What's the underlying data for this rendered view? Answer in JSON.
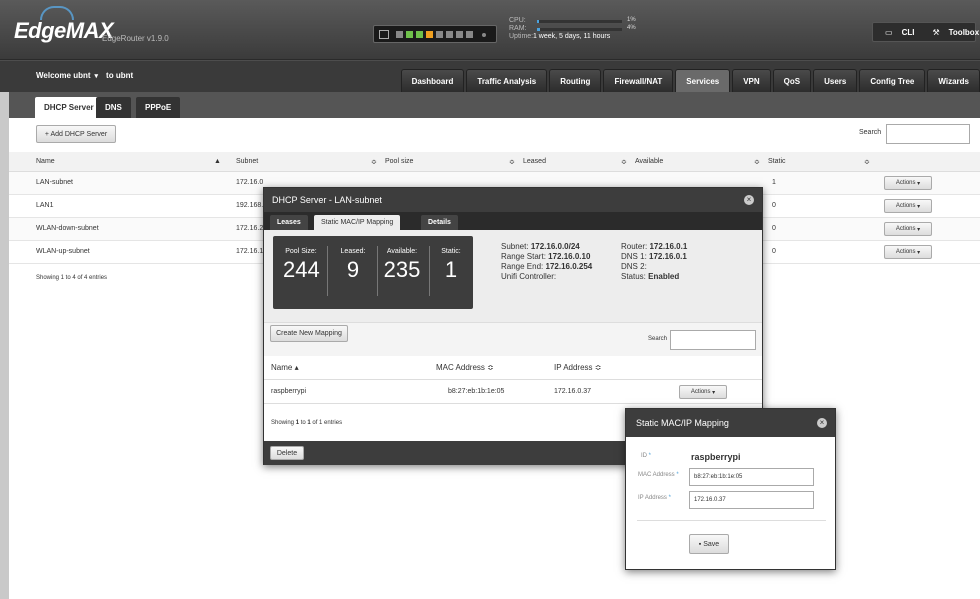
{
  "header": {
    "logo": "EdgeMAX",
    "router_name": "EdgeRouter v1.9.0",
    "cpu_label": "CPU:",
    "cpu_pct": "1%",
    "cpu_value": 1,
    "ram_label": "RAM:",
    "ram_pct": "4%",
    "ram_value": 4,
    "uptime_label": "Uptime:",
    "uptime_value": "1 week, 5 days, 11 hours",
    "cli_label": "CLI",
    "toolbox_label": "Toolbox"
  },
  "nav": {
    "welcome": "Welcome ubnt",
    "to": "to ubnt",
    "tabs": [
      "Dashboard",
      "Traffic Analysis",
      "Routing",
      "Firewall/NAT",
      "Services",
      "VPN",
      "QoS",
      "Users",
      "Config Tree",
      "Wizards"
    ],
    "active": "Services"
  },
  "subtabs": [
    "DHCP Server",
    "DNS",
    "PPPoE"
  ],
  "toolbar": {
    "add_label": "+ Add DHCP Server",
    "search_label": "Search"
  },
  "table": {
    "headers": [
      "Name",
      "Subnet",
      "Pool size",
      "Leased",
      "Available",
      "Static"
    ],
    "rows": [
      {
        "name": "LAN-subnet",
        "subnet": "172.16.0",
        "static": "1",
        "actions": "Actions"
      },
      {
        "name": "LAN1",
        "subnet": "192.168.",
        "static": "0",
        "actions": "Actions"
      },
      {
        "name": "WLAN-down-subnet",
        "subnet": "172.16.2",
        "static": "0",
        "actions": "Actions"
      },
      {
        "name": "WLAN-up-subnet",
        "subnet": "172.16.1",
        "static": "0",
        "actions": "Actions"
      }
    ],
    "showing": "Showing 1 to 4 of 4 entries"
  },
  "dialog": {
    "title": "DHCP Server - LAN-subnet",
    "tabs": [
      "Leases",
      "Static MAC/IP Mapping",
      "Details"
    ],
    "pool_size_label": "Pool Size:",
    "pool_size": "244",
    "leased_label": "Leased:",
    "leased": "9",
    "available_label": "Available:",
    "available": "235",
    "static_label": "Static:",
    "static": "1",
    "subnet_label": "Subnet:",
    "subnet": "172.16.0.0/24",
    "range_start_label": "Range Start:",
    "range_start": "172.16.0.10",
    "range_end_label": "Range End:",
    "range_end": "172.16.0.254",
    "unifi_label": "Unifi Controller:",
    "router_label": "Router:",
    "router": "172.16.0.1",
    "dns1_label": "DNS 1:",
    "dns1": "172.16.0.1",
    "dns2_label": "DNS 2:",
    "status_label": "Status:",
    "status": "Enabled",
    "create_label": "Create New Mapping",
    "search_label": "Search",
    "col_name": "Name ▴",
    "col_mac": "MAC Address ≎",
    "col_ip": "IP Address ≎",
    "row": {
      "name": "raspberrypi",
      "mac": "b8:27:eb:1b:1e:05",
      "ip": "172.16.0.37",
      "actions": "Actions"
    },
    "showing_pre": "Showing ",
    "showing_a": "1",
    "showing_mid": " to ",
    "showing_b": "1",
    "showing_post": " of 1 entries",
    "delete_label": "Delete"
  },
  "mapping": {
    "title": "Static MAC/IP Mapping",
    "id_label": "ID",
    "id_value": "raspberrypi",
    "mac_label": "MAC Address",
    "mac_value": "b8:27:eb:1b:1e:05",
    "ip_label": "IP Address",
    "ip_value": "172.16.0.37",
    "save_label": "Save"
  }
}
